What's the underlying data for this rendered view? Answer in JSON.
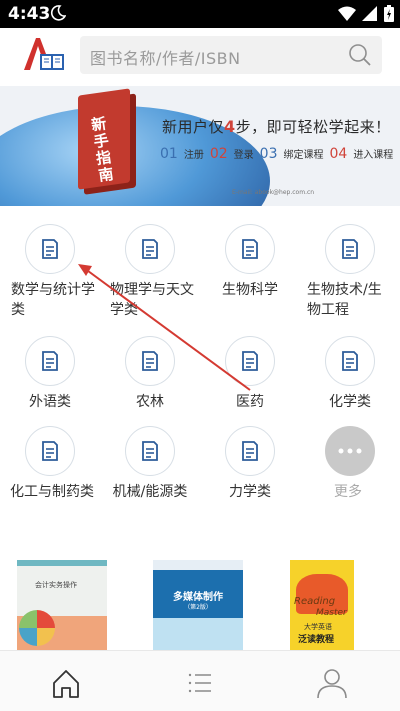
{
  "status_bar": {
    "time": "4:43"
  },
  "header": {
    "search_placeholder": "图书名称/作者/ISBN"
  },
  "banner": {
    "book_title": "新手指南",
    "headline_pre": "新用户仅",
    "headline_num": "4",
    "headline_post": "步，即可轻松学起来！",
    "steps": [
      {
        "num": "01",
        "label": "注册",
        "color": "#3a6fb0"
      },
      {
        "num": "02",
        "label": "登录",
        "color": "#d0443a"
      },
      {
        "num": "03",
        "label": "绑定课程",
        "color": "#3a6fb0"
      },
      {
        "num": "04",
        "label": "进入课程",
        "color": "#d0443a"
      }
    ],
    "email": "E-mail: abook@hep.com.cn"
  },
  "categories": [
    {
      "label": "数学与统计学类"
    },
    {
      "label": "物理学与天文学类"
    },
    {
      "label": "生物科学"
    },
    {
      "label": "生物技术/生物工程"
    },
    {
      "label": "外语类"
    },
    {
      "label": "农林"
    },
    {
      "label": "医药"
    },
    {
      "label": "化学类"
    },
    {
      "label": "化工与制药类"
    },
    {
      "label": "机械/能源类"
    },
    {
      "label": "力学类"
    },
    {
      "label": "更多"
    }
  ],
  "covers": [
    {
      "title": "会计实务操作"
    },
    {
      "title": "多媒体制作",
      "edition": "（第2版）"
    },
    {
      "title_en_1": "Reading",
      "title_en_2": "Master",
      "title_cn_1": "大学英语",
      "title_cn_2": "泛读教程"
    }
  ],
  "colors": {
    "accent": "#3a6fb0",
    "red": "#d0443a",
    "arrow": "#d43a32"
  }
}
